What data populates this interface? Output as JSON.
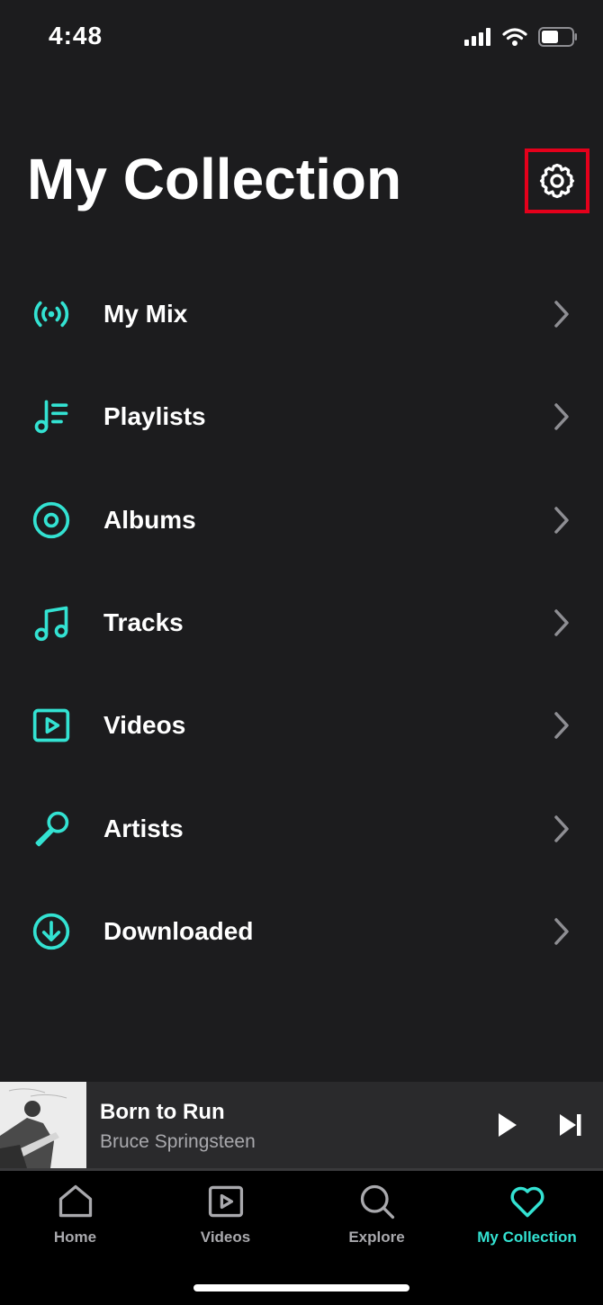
{
  "status_bar": {
    "time": "4:48",
    "signal_icon": "cellular-signal-icon",
    "wifi_icon": "wifi-icon",
    "battery_icon": "battery-icon"
  },
  "header": {
    "title": "My Collection",
    "settings_icon": "gear-icon"
  },
  "menu": {
    "items": [
      {
        "label": "My Mix",
        "icon": "broadcast-icon"
      },
      {
        "label": "Playlists",
        "icon": "playlist-icon"
      },
      {
        "label": "Albums",
        "icon": "album-icon"
      },
      {
        "label": "Tracks",
        "icon": "music-note-icon"
      },
      {
        "label": "Videos",
        "icon": "video-icon"
      },
      {
        "label": "Artists",
        "icon": "microphone-icon"
      },
      {
        "label": "Downloaded",
        "icon": "download-icon"
      }
    ]
  },
  "now_playing": {
    "title": "Born to Run",
    "artist": "Bruce Springsteen",
    "progress": 0.0
  },
  "tab_bar": {
    "tabs": [
      {
        "label": "Home",
        "icon": "home-icon",
        "active": false
      },
      {
        "label": "Videos",
        "icon": "video-tab-icon",
        "active": false
      },
      {
        "label": "Explore",
        "icon": "search-icon",
        "active": false
      },
      {
        "label": "My Collection",
        "icon": "heart-icon",
        "active": true
      }
    ]
  },
  "colors": {
    "background": "#1c1c1e",
    "accent": "#33e2d2",
    "highlight_border": "#e4001b",
    "muted_text": "#a9a9ad"
  }
}
